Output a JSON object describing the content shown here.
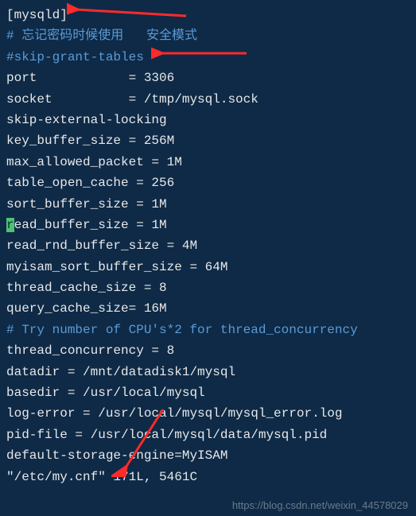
{
  "lines": {
    "l0": "[mysqld]",
    "l1_a": "# 忘记密码时候使用",
    "l1_b": "安全模式",
    "l2": "#skip-grant-tables",
    "l3": "port            = 3306",
    "l4": "socket          = /tmp/mysql.sock",
    "l5": "skip-external-locking",
    "l6": "key_buffer_size = 256M",
    "l7": "max_allowed_packet = 1M",
    "l8": "table_open_cache = 256",
    "l9": "sort_buffer_size = 1M",
    "l10_a": "r",
    "l10_b": "ead_buffer_size = 1M",
    "l11": "read_rnd_buffer_size = 4M",
    "l12": "myisam_sort_buffer_size = 64M",
    "l13": "thread_cache_size = 8",
    "l14": "query_cache_size= 16M",
    "l15": "# Try number of CPU's*2 for thread_concurrency",
    "l16": "thread_concurrency = 8",
    "l17": "datadir = /mnt/datadisk1/mysql",
    "l18": "basedir = /usr/local/mysql",
    "l19": "log-error = /usr/local/mysql/mysql_error.log",
    "l20": "pid-file = /usr/local/mysql/data/mysql.pid",
    "l21": "default-storage-engine=MyISAM",
    "l22": "\"/etc/my.cnf\" 171L, 5461C"
  },
  "watermark": "https://blog.csdn.net/weixin_44578029"
}
